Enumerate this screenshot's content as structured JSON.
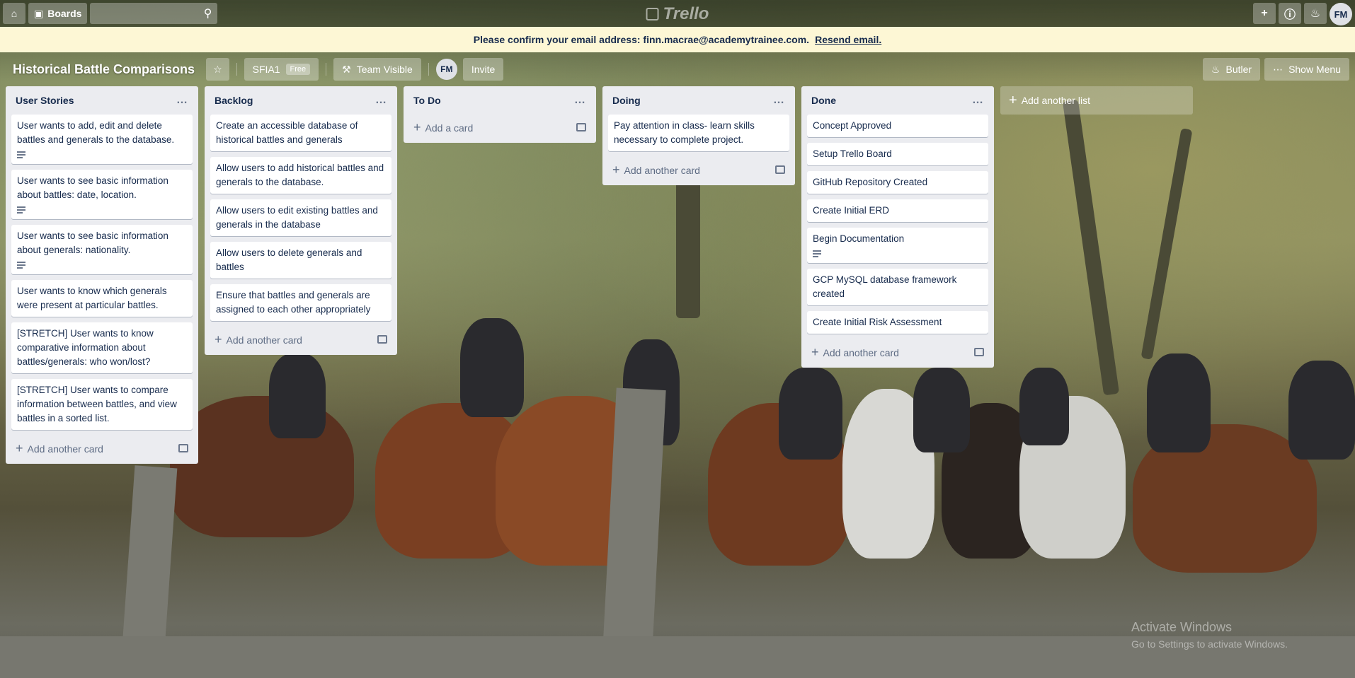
{
  "header": {
    "boards_label": "Boards",
    "logo_text": "Trello",
    "avatar_initials": "FM"
  },
  "banner": {
    "message": "Please confirm your email address: finn.macrae@academytrainee.com.",
    "resend_label": "Resend email."
  },
  "board": {
    "title": "Historical Battle Comparisons",
    "team_name": "SFIA1",
    "team_badge": "Free",
    "visibility_label": "Team Visible",
    "member_initials": "FM",
    "invite_label": "Invite",
    "butler_label": "Butler",
    "menu_label": "Show Menu"
  },
  "lists": [
    {
      "title": "User Stories",
      "cards": [
        {
          "text": "User wants to add, edit and delete battles and generals to the database.",
          "has_description": true
        },
        {
          "text": "User wants to see basic information about battles: date, location.",
          "has_description": true
        },
        {
          "text": "User wants to see basic information about generals: nationality.",
          "has_description": true
        },
        {
          "text": "User wants to know which generals were present at particular battles.",
          "has_description": false
        },
        {
          "text": "[STRETCH] User wants to know comparative information about battles/generals: who won/lost?",
          "has_description": false
        },
        {
          "text": "[STRETCH] User wants to compare information between battles, and view battles in a sorted list.",
          "has_description": false
        }
      ],
      "add_label": "Add another card"
    },
    {
      "title": "Backlog",
      "cards": [
        {
          "text": "Create an accessible database of historical battles and generals",
          "has_description": false
        },
        {
          "text": "Allow users to add historical battles and generals to the database.",
          "has_description": false
        },
        {
          "text": "Allow users to edit existing battles and generals in the database",
          "has_description": false
        },
        {
          "text": "Allow users to delete generals and battles",
          "has_description": false
        },
        {
          "text": "Ensure that battles and generals are assigned to each other appropriately",
          "has_description": false
        }
      ],
      "add_label": "Add another card"
    },
    {
      "title": "To Do",
      "cards": [],
      "add_label": "Add a card"
    },
    {
      "title": "Doing",
      "cards": [
        {
          "text": "Pay attention in class- learn skills necessary to complete project.",
          "has_description": false
        }
      ],
      "add_label": "Add another card"
    },
    {
      "title": "Done",
      "cards": [
        {
          "text": "Concept Approved",
          "has_description": false
        },
        {
          "text": "Setup Trello Board",
          "has_description": false
        },
        {
          "text": "GitHub Repository Created",
          "has_description": false
        },
        {
          "text": "Create Initial ERD",
          "has_description": false
        },
        {
          "text": "Begin Documentation",
          "has_description": true
        },
        {
          "text": "GCP MySQL database framework created",
          "has_description": false
        },
        {
          "text": "Create Initial Risk Assessment",
          "has_description": false
        }
      ],
      "add_label": "Add another card"
    }
  ],
  "add_list_label": "Add another list",
  "watermark": {
    "title": "Activate Windows",
    "subtitle": "Go to Settings to activate Windows."
  }
}
